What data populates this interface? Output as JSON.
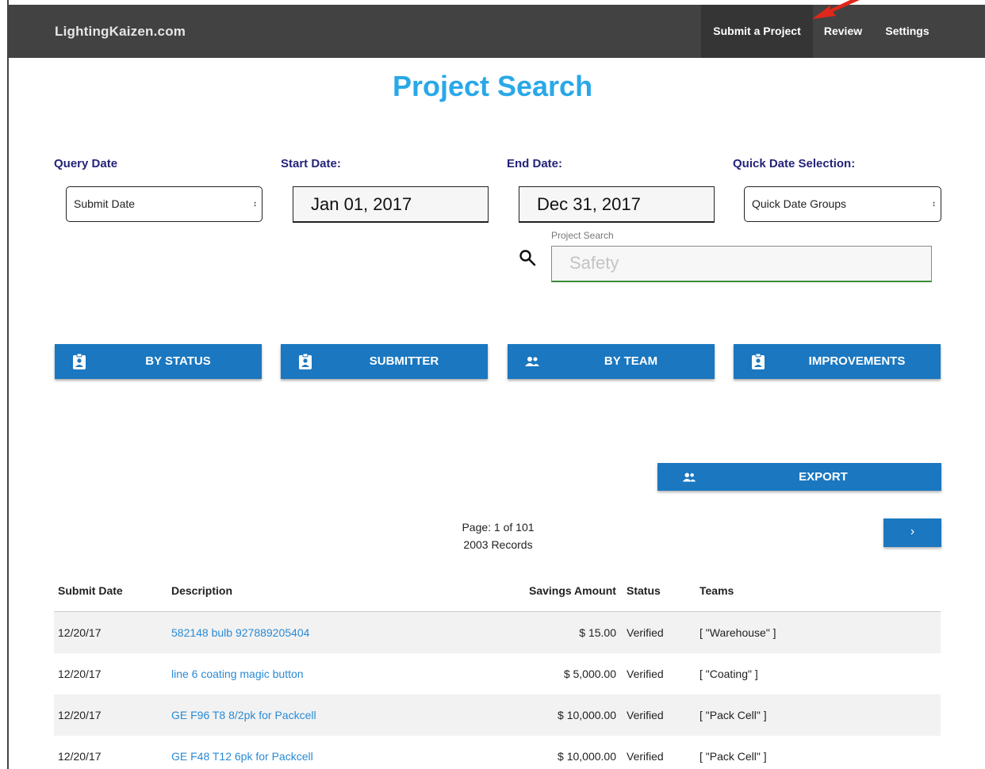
{
  "nav": {
    "brand": "LightingKaizen.com",
    "items": [
      {
        "label": "Submit a Project",
        "active": true
      },
      {
        "label": "Review",
        "active": false
      },
      {
        "label": "Settings",
        "active": false
      }
    ]
  },
  "page_title": "Project Search",
  "filters": {
    "query_date_label": "Query Date",
    "query_date_value": "Submit Date",
    "start_date_label": "Start Date:",
    "start_date_value": "Jan 01, 2017",
    "end_date_label": "End Date:",
    "end_date_value": "Dec 31, 2017",
    "quick_date_label": "Quick Date Selection:",
    "quick_date_value": "Quick Date Groups",
    "project_search_label": "Project Search",
    "project_search_placeholder": "Safety"
  },
  "group_buttons": [
    {
      "label": "BY STATUS",
      "icon": "badge-icon"
    },
    {
      "label": "SUBMITTER",
      "icon": "badge-icon"
    },
    {
      "label": "BY TEAM",
      "icon": "group-icon"
    },
    {
      "label": "IMPROVEMENTS",
      "icon": "badge-icon"
    }
  ],
  "export_label": "EXPORT",
  "pager": {
    "page_text": "Page: 1 of 101",
    "records_text": "2003 Records",
    "next_label": "›"
  },
  "table": {
    "headers": [
      "Submit Date",
      "Description",
      "Savings Amount",
      "Status",
      "Teams"
    ],
    "rows": [
      {
        "date": "12/20/17",
        "description": "582148 bulb 927889205404",
        "amount": "$ 15.00",
        "status": "Verified",
        "teams": "[ \"Warehouse\" ]"
      },
      {
        "date": "12/20/17",
        "description": "line 6 coating magic button",
        "amount": "$ 5,000.00",
        "status": "Verified",
        "teams": "[ \"Coating\" ]"
      },
      {
        "date": "12/20/17",
        "description": "GE F96 T8 8/2pk for Packcell",
        "amount": "$ 10,000.00",
        "status": "Verified",
        "teams": "[ \"Pack Cell\" ]"
      },
      {
        "date": "12/20/17",
        "description": "GE F48 T12 6pk for Packcell",
        "amount": "$ 10,000.00",
        "status": "Verified",
        "teams": "[ \"Pack Cell\" ]"
      }
    ]
  },
  "colors": {
    "navbar": "#424242",
    "accent": "#1a77c0",
    "title": "#29a8e8",
    "label": "#24247a",
    "link": "#2a8ad4",
    "annotation_arrow": "#e0271b"
  }
}
